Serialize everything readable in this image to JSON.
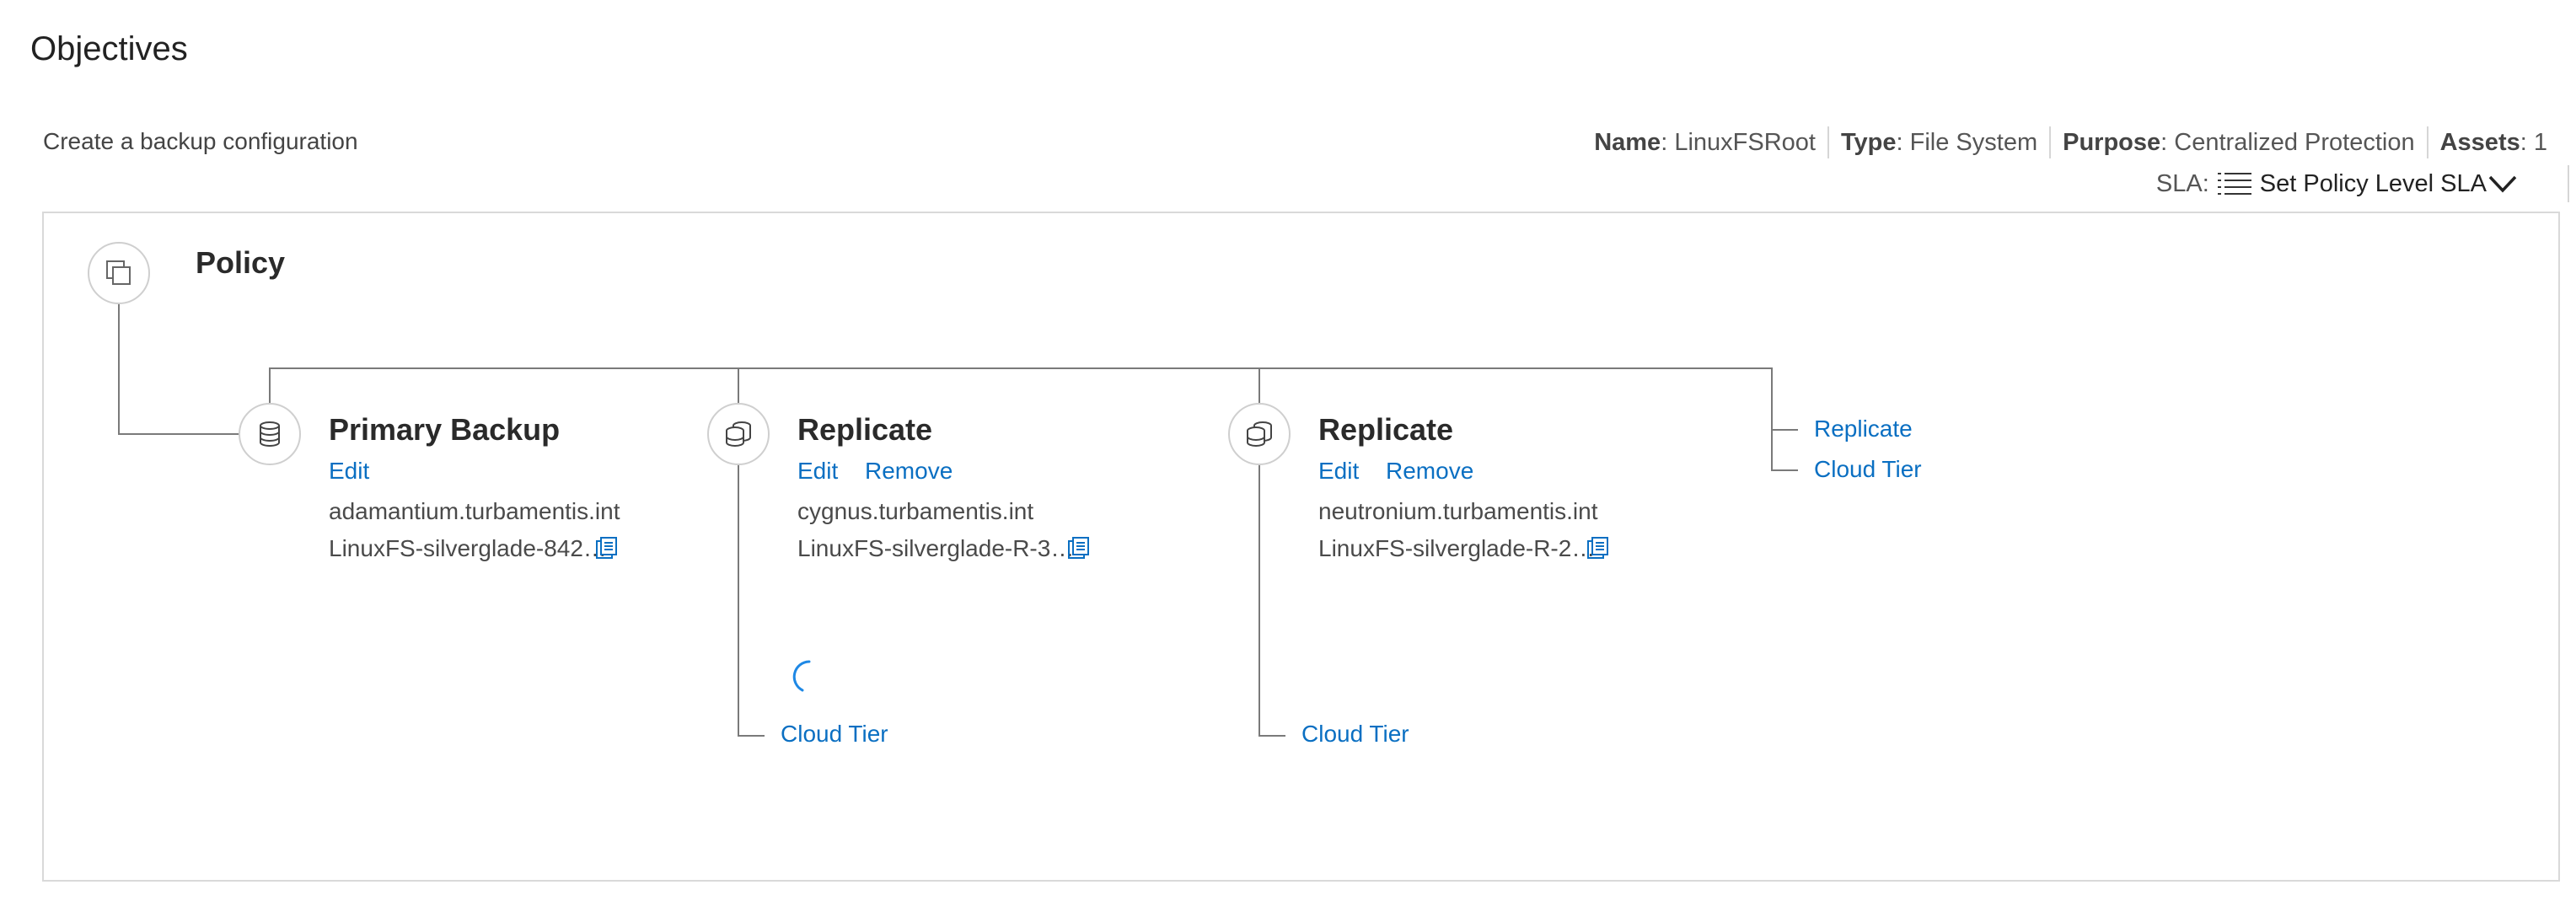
{
  "page": {
    "title": "Objectives",
    "subtitle": "Create a backup configuration"
  },
  "meta": {
    "name_label": "Name",
    "name_value": "LinuxFSRoot",
    "type_label": "Type",
    "type_value": "File System",
    "purpose_label": "Purpose",
    "purpose_value": "Centralized Protection",
    "assets_label": "Assets",
    "assets_value": "1",
    "separator": ": ",
    "sla_label": "SLA:",
    "sla_value": "Set Policy Level SLA",
    "sla_icon": "list-icon"
  },
  "policy": {
    "title": "Policy",
    "icon": "copy-stack-icon"
  },
  "primary": {
    "title": "Primary Backup",
    "edit_label": "Edit",
    "host": "adamantium.turbamentis.int",
    "storage": "LinuxFS-silverglade-842…",
    "icon": "database-icon"
  },
  "replicate1": {
    "title": "Replicate",
    "edit_label": "Edit",
    "remove_label": "Remove",
    "host": "cygnus.turbamentis.int",
    "storage": "LinuxFS-silverglade-R-3…",
    "cloud_tier_label": "Cloud Tier",
    "icon": "database-stack-icon"
  },
  "replicate2": {
    "title": "Replicate",
    "edit_label": "Edit",
    "remove_label": "Remove",
    "host": "neutronium.turbamentis.int",
    "storage": "LinuxFS-silverglade-R-2…",
    "cloud_tier_label": "Cloud Tier",
    "icon": "database-stack-icon"
  },
  "add_actions": {
    "replicate_label": "Replicate",
    "cloud_tier_label": "Cloud Tier"
  },
  "colors": {
    "link": "#0a6fc2",
    "line": "#7a7a7a",
    "border": "#d9d9d9"
  }
}
